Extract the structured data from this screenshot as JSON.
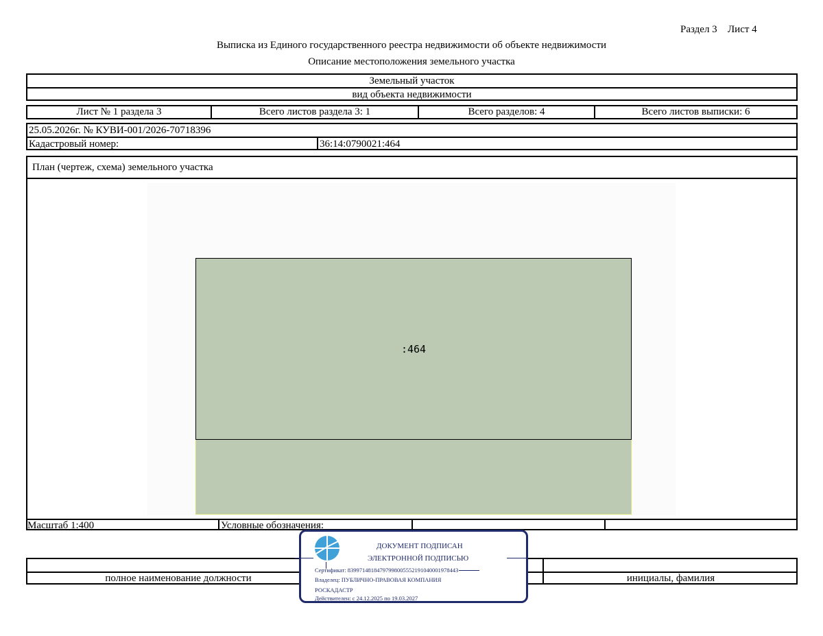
{
  "header": {
    "section_label": "Раздел 3",
    "sheet_label": "Лист 4",
    "title": "Выписка из Единого государственного реестра недвижимости об объекте недвижимости",
    "subtitle": "Описание местоположения земельного участка"
  },
  "object": {
    "type": "Земельный участок",
    "type_caption": "вид объекта недвижимости"
  },
  "sheets": {
    "sheet_of_section": "Лист № 1 раздела 3",
    "total_section_sheets": "Всего листов раздела 3: 1",
    "total_sections": "Всего разделов: 4",
    "total_extract_sheets": "Всего листов выписки: 6"
  },
  "record": {
    "date_number": "25.05.2026г. № КУВИ-001/2026-70718396",
    "cadastral_label": "Кадастровый номер:",
    "cadastral_number": "36:14:0790021:464"
  },
  "plan": {
    "heading": "План (чертеж, схема) земельного участка",
    "parcel_label": ":464",
    "parcel_fill": "#bccab3",
    "scale": "Масштаб 1:400",
    "legend_label": "Условные обозначения:"
  },
  "signature": {
    "position_caption": "полное наименование должности",
    "name_caption": "инициалы, фамилия"
  },
  "stamp": {
    "line1": "ДОКУМЕНТ ПОДПИСАН",
    "line2": "ЭЛЕКТРОННОЙ ПОДПИСЬЮ",
    "certificate": "Сертификат: 8399714818479799800555219104000197844З",
    "owner_line1": "Владелец: ПУБЛИЧНО-ПРАВОВАЯ КОМПАНИЯ",
    "owner_line2": "РОСКАДАСТР",
    "validity": "Действителен: с 24.12.2025 по 19.03.2027",
    "color": "#1f2a6b",
    "logo_color": "#3fa1d8"
  }
}
